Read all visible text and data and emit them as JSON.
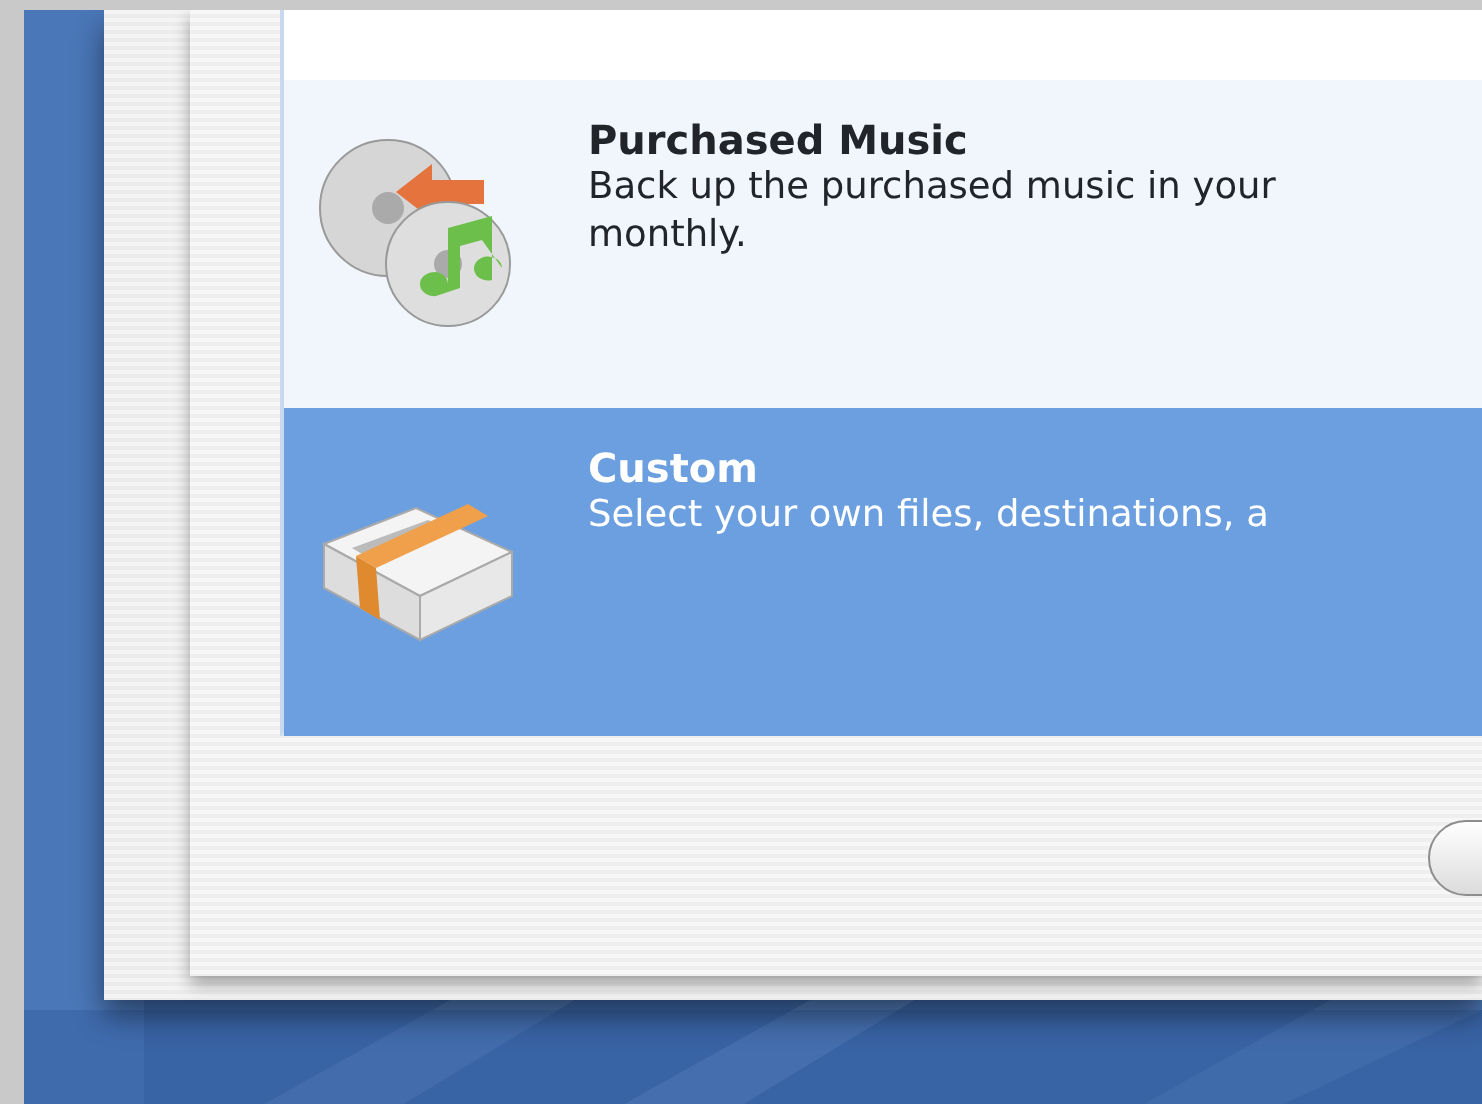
{
  "plans": [
    {
      "kind": "music",
      "title": "Purchased Music",
      "description_lines": [
        "Back up the purchased music in your",
        "monthly."
      ],
      "selected": false
    },
    {
      "kind": "documents",
      "title": "Custom",
      "description_lines": [
        "Select your own files, destinations, a"
      ],
      "selected": true
    }
  ]
}
